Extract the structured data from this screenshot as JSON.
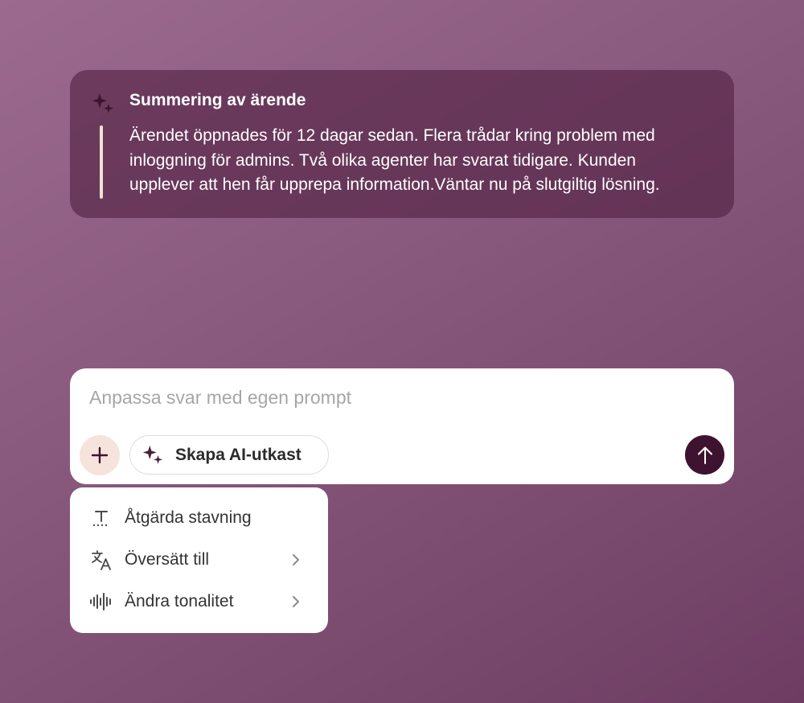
{
  "summary": {
    "title": "Summering av ärende",
    "lines": [
      "Ärendet öppnades för 12 dagar sedan. Flera trådar kring problem med",
      "inloggning för admins. Två olika agenter har svarat tidigare. Kunden",
      "upplever att hen får upprepa information.Väntar nu på slutgiltig lösning."
    ],
    "icon": "sparkles-icon"
  },
  "composer": {
    "placeholder": "Anpassa svar med egen prompt",
    "value": "",
    "add_icon": "plus-icon",
    "ai_draft_label": "Skapa AI-utkast",
    "ai_draft_icon": "sparkles-icon",
    "send_icon": "arrow-up-icon"
  },
  "menu": {
    "items": [
      {
        "label": "Åtgärda stavning",
        "icon": "spellcheck-icon",
        "has_submenu": false
      },
      {
        "label": "Översätt till",
        "icon": "translate-icon",
        "has_submenu": true
      },
      {
        "label": "Ändra tonalitet",
        "icon": "audio-wave-icon",
        "has_submenu": true
      }
    ]
  },
  "colors": {
    "background_start": "#9b6a8e",
    "background_end": "#6e3c62",
    "summary_card": "#5a2a4c",
    "accent_bar": "#f6e0d6",
    "add_button_bg": "#f6e3dc",
    "send_button_bg": "#3e1330",
    "icon_plum": "#4a1f3d"
  }
}
